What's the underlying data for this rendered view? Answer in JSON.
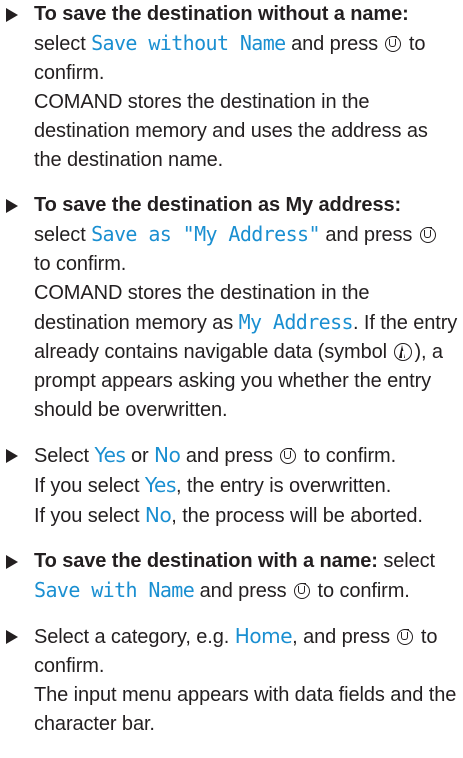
{
  "steps": [
    {
      "lead": "To save the destination without a name:",
      "t1": " select ",
      "hl1": "Save without Name",
      "t2": " and press ",
      "t3": " to confirm.",
      "result": "COMAND stores the destination in the destination memory and uses the address as the destination name."
    },
    {
      "lead": "To save the destination as My address:",
      "t1": " select ",
      "hl1": "Save as \"My Address\"",
      "t2": " and press ",
      "t3": " to confirm.",
      "r1": "COMAND stores the destination in the destination memory as ",
      "hl2": "My Address",
      "r2": ". If the entry already contains navigable data (symbol ",
      "r3": "), a prompt appears asking you whether the entry should be overwritten."
    },
    {
      "t0": "Select ",
      "hl1": "Yes",
      "t1": " or ",
      "hl2": "No",
      "t2": " and press ",
      "t3": " to confirm.",
      "l2a": "If you select ",
      "hl3": "Yes",
      "l2b": ", the entry is overwritten.",
      "l3a": "If you select ",
      "hl4": "No",
      "l3b": ", the process will be aborted."
    },
    {
      "lead": "To save the destination with a name:",
      "t1": " select ",
      "hl1": "Save with Name",
      "t2": " and press ",
      "t3": " to confirm."
    },
    {
      "t0": "Select a category, e.g. ",
      "hl1": "Home",
      "t1": ", and press ",
      "t2": " to confirm.",
      "result": "The input menu appears with data fields and the character bar."
    }
  ]
}
